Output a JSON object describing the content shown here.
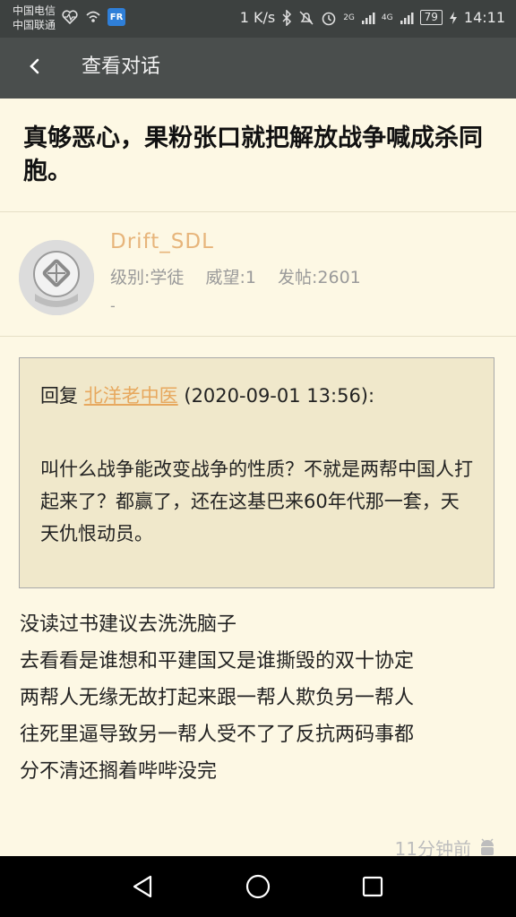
{
  "status_bar": {
    "carrier_1": "中国电信",
    "carrier_2": "中国联通",
    "speed": "1 K/s",
    "network_1": "2G",
    "network_2": "4G",
    "battery": "79",
    "time": "14:11",
    "app_badge": "FR",
    "icons": [
      "heart-monitor-icon",
      "wifi-hotspot-icon",
      "bluetooth-icon",
      "mute-icon",
      "alarm-icon",
      "signal-icon",
      "charging-icon"
    ]
  },
  "app_bar": {
    "back_icon": "chevron-left-icon",
    "title": "查看对话"
  },
  "post": {
    "title": "真够恶心，果粉张口就把解放战争喊成杀同胞。"
  },
  "author": {
    "name": "Drift_SDL",
    "level": "级别:学徒",
    "prestige": "威望:1",
    "posts": "发帖:2601",
    "signature": "-"
  },
  "quote": {
    "prefix": "回复",
    "quoted_user": "北洋老中医",
    "time": "(2020-09-01 13:56):",
    "body": "叫什么战争能改变战争的性质？不就是两帮中国人打起来了？都赢了，还在这基巴来60年代那一套，天天仇恨动员。"
  },
  "reply": {
    "lines": [
      "没读过书建议去洗洗脑子",
      "去看看是谁想和平建国又是谁撕毁的双十协定",
      "两帮人无缘无故打起来跟一帮人欺负另一帮人",
      "往死里逼导致另一帮人受不了了反抗两码事都",
      "分不清还搁着哔哔没完"
    ],
    "time": "11分钟前",
    "device_icon": "android-icon"
  },
  "nav": [
    "back-triangle-icon",
    "home-circle-icon",
    "recents-square-icon"
  ],
  "colors": {
    "background": "#fdf8e4",
    "app_bar": "#4a4e4d",
    "status_bar": "#3d4140",
    "username": "#e7b57b",
    "link": "#e7a85e",
    "quote_bg": "#f0e8cb"
  }
}
